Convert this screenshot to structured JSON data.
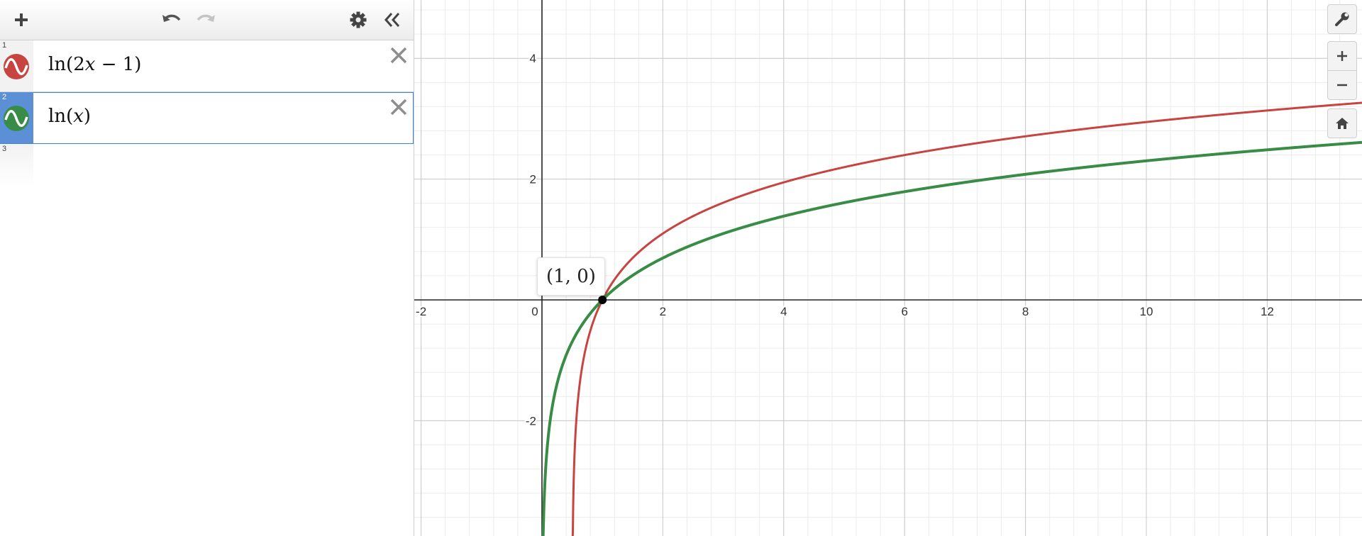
{
  "toolbar": {
    "add_icon": "plus-icon",
    "undo_icon": "undo-icon",
    "redo_icon": "redo-icon",
    "settings_icon": "gear-icon",
    "collapse_icon": "double-chevron-left-icon"
  },
  "expressions": [
    {
      "num": "1",
      "color": "#c74440",
      "parts": [
        "ln",
        "(",
        "2",
        "x",
        " − 1",
        ")"
      ]
    },
    {
      "num": "2",
      "color": "#388c46",
      "parts": [
        "ln",
        "(",
        "",
        "x",
        "",
        ")"
      ]
    },
    {
      "num": "3"
    }
  ],
  "point_label": "(1, 0)",
  "graph_controls": {
    "settings_icon": "wrench-icon",
    "zoom_in_icon": "plus-icon",
    "zoom_out_icon": "minus-icon",
    "home_icon": "home-icon"
  },
  "colors": {
    "selected": "#3e82d6",
    "red": "#c74440",
    "green": "#388c46"
  },
  "chart_data": {
    "type": "line",
    "xlim": [
      -2.2,
      13.5
    ],
    "ylim": [
      -3.9,
      4.9
    ],
    "x_ticks": [
      "-2",
      "0",
      "2",
      "4",
      "6",
      "8",
      "10",
      "12"
    ],
    "y_ticks": [
      "4",
      "2",
      "-2"
    ],
    "grid": true,
    "series": [
      {
        "function": "ln(2x − 1)",
        "color": "#c74440"
      },
      {
        "function": "ln(x)",
        "color": "#388c46"
      }
    ],
    "points": [
      {
        "x": 1,
        "y": 0
      }
    ]
  }
}
